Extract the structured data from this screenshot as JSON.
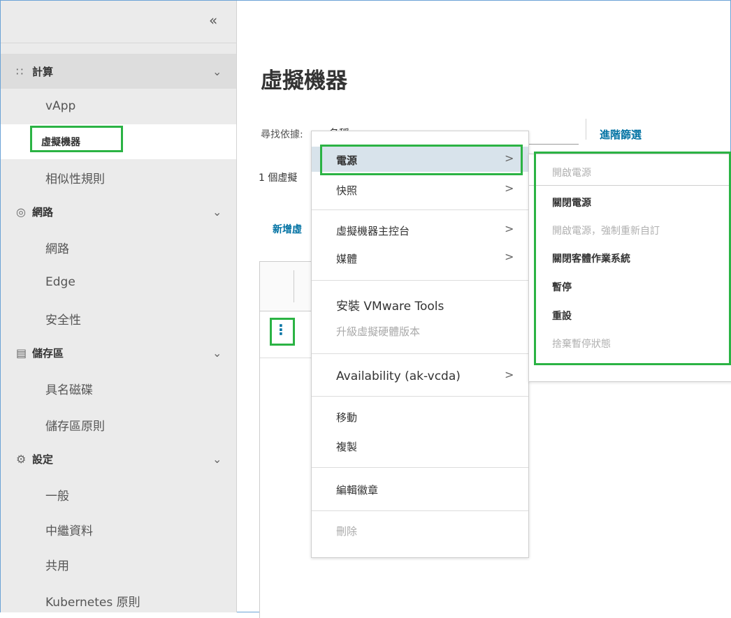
{
  "sidebar": {
    "collapse_label": "«",
    "groups": [
      {
        "icon": "grid-icon",
        "label": "計算",
        "items": [
          "vApp",
          "虛擬機器",
          "相似性規則"
        ]
      },
      {
        "icon": "network-icon",
        "label": "網路",
        "items": [
          "網路",
          "Edge",
          "安全性"
        ]
      },
      {
        "icon": "storage-icon",
        "label": "儲存區",
        "items": [
          "具名磁碟",
          "儲存區原則"
        ]
      },
      {
        "icon": "gear-icon",
        "label": "設定",
        "items": [
          "一般",
          "中繼資料",
          "共用",
          "Kubernetes 原則"
        ]
      }
    ],
    "active_item": "虛擬機器"
  },
  "main": {
    "title": "虛擬機器",
    "search_label": "尋找依據:",
    "search_value": "名稱",
    "advanced_filter": "進階篩選",
    "count_text": "1 個虛擬",
    "add_button": "新增虛"
  },
  "context_menu": {
    "items": [
      {
        "label": "電源",
        "submenu": true,
        "selected": true
      },
      {
        "label": "快照",
        "submenu": true
      },
      {
        "label": "虛擬機器主控台",
        "submenu": true
      },
      {
        "label": "媒體",
        "submenu": true
      },
      {
        "label": "安裝 VMware Tools"
      },
      {
        "label": "升級虛擬硬體版本",
        "disabled": true
      },
      {
        "label": "Availability (ak-vcda)",
        "submenu": true
      },
      {
        "label": "移動"
      },
      {
        "label": "複製"
      },
      {
        "label": "編輯徽章"
      },
      {
        "label": "刪除",
        "disabled": true
      }
    ],
    "arrow": ">"
  },
  "power_submenu": {
    "items": [
      {
        "label": "開啟電源",
        "disabled": true
      },
      {
        "label": "關閉電源"
      },
      {
        "label": "開啟電源，強制重新自訂",
        "disabled": true
      },
      {
        "label": "關閉客體作業系統"
      },
      {
        "label": "暫停"
      },
      {
        "label": "重設"
      },
      {
        "label": "捨棄暫停狀態",
        "disabled": true
      }
    ]
  },
  "colors": {
    "highlight": "#2bb344",
    "link": "#0072a3",
    "sidebar_bg": "#ebebeb",
    "selected_menu_bg": "#d8e3eb"
  }
}
